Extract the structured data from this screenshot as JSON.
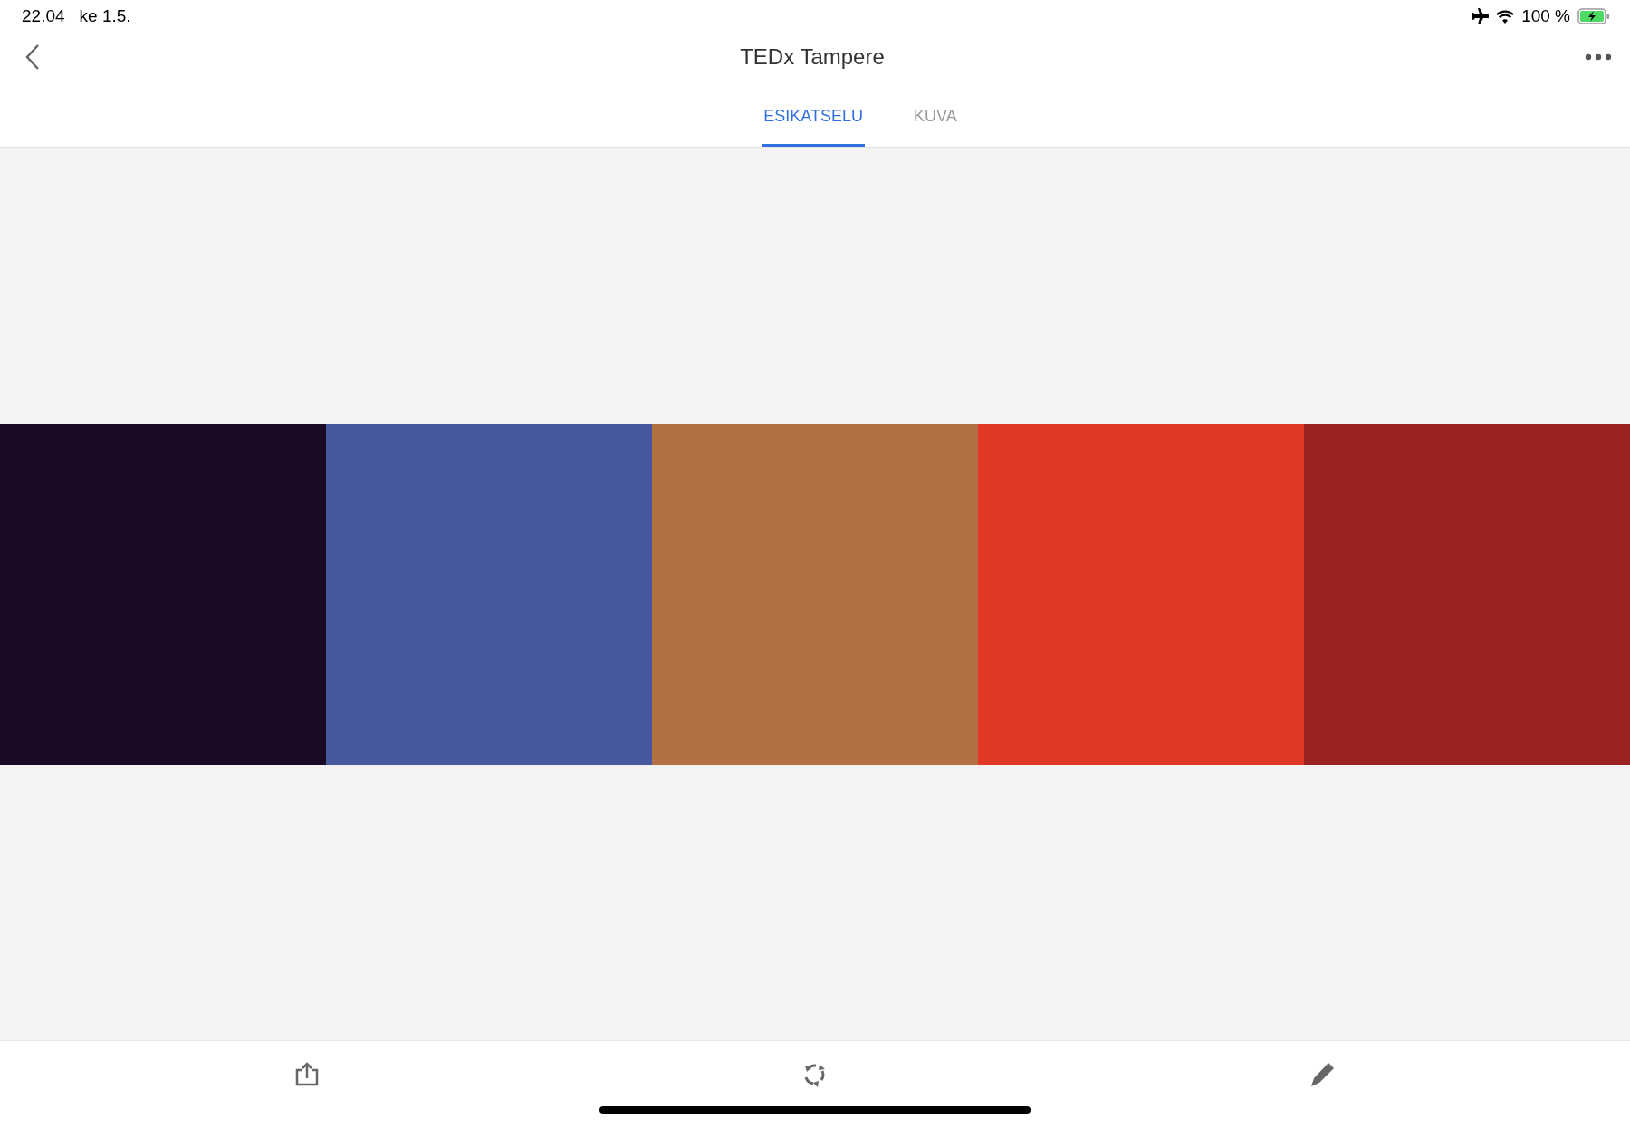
{
  "status_bar": {
    "time": "22.04",
    "date": "ke 1.5.",
    "battery": "100 %"
  },
  "header": {
    "title": "TEDx Tampere"
  },
  "tabs": [
    {
      "label": "ESIKATSELU",
      "selected": true
    },
    {
      "label": "KUVA",
      "selected": false
    }
  ],
  "swatches": [
    {
      "color": "#1b0a26"
    },
    {
      "color": "#4659a0"
    },
    {
      "color": "#b37045"
    },
    {
      "color": "#e03825"
    },
    {
      "color": "#9a2320"
    }
  ]
}
